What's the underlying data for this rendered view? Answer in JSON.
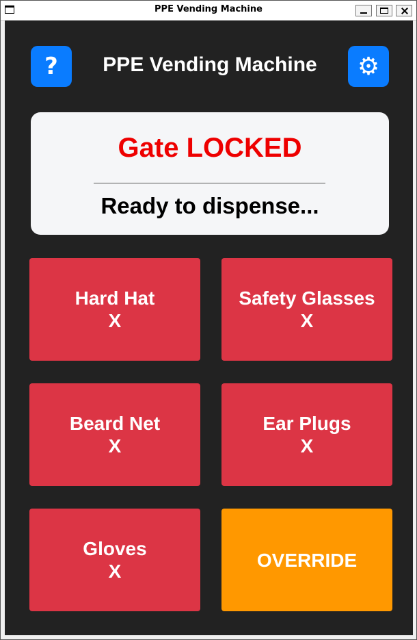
{
  "window": {
    "title": "PPE Vending Machine",
    "controls": [
      "minimize",
      "maximize",
      "close"
    ]
  },
  "header": {
    "help_label": "?",
    "settings_icon": "gear-icon",
    "title": "PPE Vending Machine"
  },
  "status": {
    "gate": "Gate LOCKED",
    "gate_color": "#ee0000",
    "message": "Ready to dispense..."
  },
  "products": [
    {
      "name": "Hard Hat",
      "state": "X"
    },
    {
      "name": "Safety Glasses",
      "state": "X"
    },
    {
      "name": "Beard Net",
      "state": "X"
    },
    {
      "name": "Ear Plugs",
      "state": "X"
    },
    {
      "name": "Gloves",
      "state": "X"
    }
  ],
  "override_label": "OVERRIDE",
  "colors": {
    "accent": "#0a7cff",
    "product_button": "#dc3545",
    "override_button": "#ff9800",
    "background": "#222222"
  }
}
